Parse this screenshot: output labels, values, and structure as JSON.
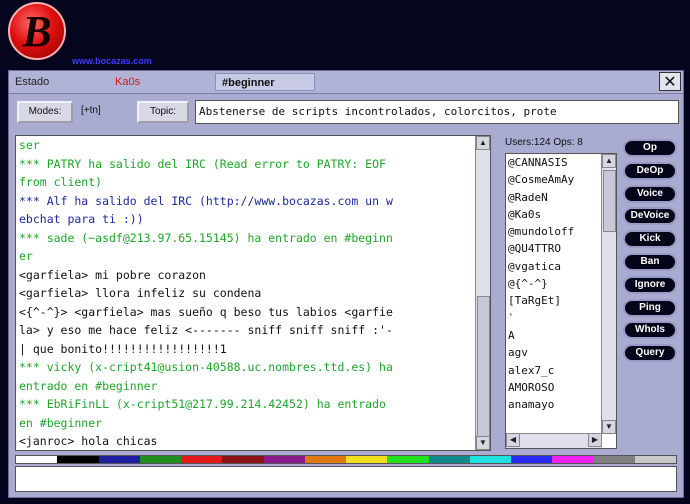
{
  "header": {
    "logo_letter": "B",
    "site_url": "www.bocazas.com"
  },
  "tabs": [
    {
      "label": "Estado"
    },
    {
      "label": "Ka0s"
    },
    {
      "label": "#beginner"
    }
  ],
  "close_glyph": "✕",
  "toolbar": {
    "modes_label": "Modes:",
    "modes_value": "[+tn]",
    "topic_label": "Topic:",
    "topic_text": "Abstenerse de scripts incontrolados, colorcitos, prote"
  },
  "chat": {
    "lines": [
      {
        "text": "ser",
        "color": "green"
      },
      {
        "text": "*** PATRY ha salido del IRC (Read error to PATRY: EOF",
        "color": "green"
      },
      {
        "text": "from client)",
        "color": "green"
      },
      {
        "text": "*** Alf ha salido del IRC (http://www.bocazas.com un w",
        "color": "blue"
      },
      {
        "text": "ebchat para ti :))",
        "color": "blue"
      },
      {
        "text": "*** sade (~asdf@213.97.65.15145) ha entrado en #beginn",
        "color": "green"
      },
      {
        "text": "er",
        "color": "green"
      },
      {
        "text": "<garfiela> mi pobre corazon",
        "color": "black"
      },
      {
        "text": "<garfiela> llora infeliz su condena",
        "color": "black"
      },
      {
        "text": "<{^-^}> <garfiela> mas sueño q beso tus labios <garfie",
        "color": "black"
      },
      {
        "text": "la> y eso me hace feliz <------- sniff sniff sniff :'-",
        "color": "black"
      },
      {
        "text": "| que bonito!!!!!!!!!!!!!!!!!1",
        "color": "black"
      },
      {
        "text": "*** vicky (x-cript41@usion-40588.uc.nombres.ttd.es) ha",
        "color": "green"
      },
      {
        "text": " entrado en #beginner",
        "color": "green"
      },
      {
        "text": "*** EbRiFinLL (x-cript51@217.99.214.42452) ha entrado",
        "color": "green"
      },
      {
        "text": "en #beginner",
        "color": "green"
      },
      {
        "text": "<janroc> hola chicas",
        "color": "black"
      }
    ]
  },
  "users_header": "Users:124 Ops: 8",
  "users": [
    "@CANNASIS",
    "@CosmeAmAy",
    "@RadeN",
    "@Ka0s",
    "@mundoloff",
    "@QU4TTRO",
    "@vgatica",
    "@{^-^}",
    "[TaRgEt]",
    "`",
    "A",
    "agv",
    "alex7_c",
    "AMOROSO",
    "anamayo"
  ],
  "actions": [
    "Op",
    "DeOp",
    "Voice",
    "DeVoice",
    "Kick",
    "Ban",
    "Ignore",
    "Ping",
    "WhoIs",
    "Query"
  ],
  "palette": [
    "#ffffff",
    "#000000",
    "#1d1da0",
    "#1e8e1e",
    "#e01a1a",
    "#8a1414",
    "#8a1a8a",
    "#e07a10",
    "#f0e020",
    "#20e020",
    "#108a8a",
    "#20e0e0",
    "#2a2af0",
    "#f020f0",
    "#808080",
    "#c8c8c8"
  ],
  "scroll": {
    "up": "▲",
    "down": "▼",
    "left": "◀",
    "right": "▶"
  }
}
